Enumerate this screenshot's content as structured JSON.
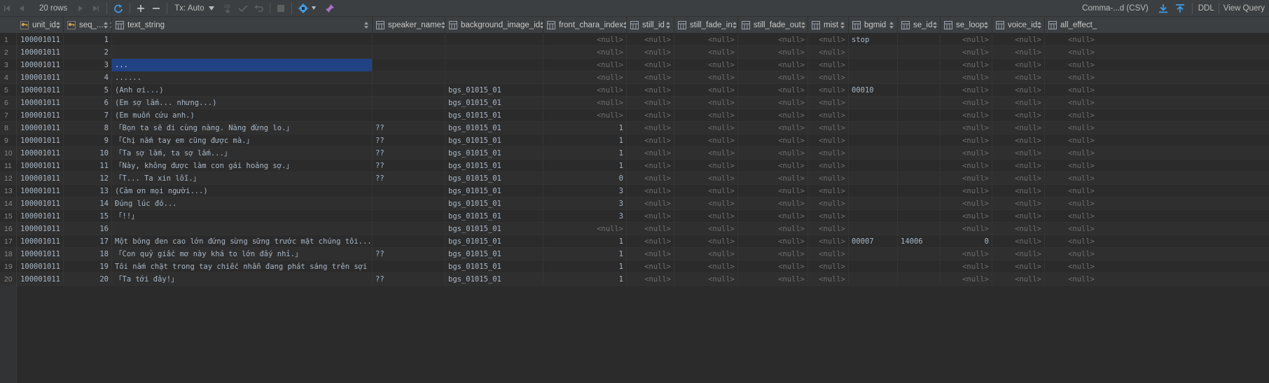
{
  "toolbar": {
    "rows_label": "20 rows",
    "tx_label": "Tx: Auto",
    "export_label": "Comma-...d (CSV)",
    "ddl_label": "DDL",
    "view_query_label": "View Query"
  },
  "columns": [
    {
      "name": "unit_id",
      "key": true,
      "sort": ""
    },
    {
      "name": "seq_...",
      "key": true,
      "sort": "1"
    },
    {
      "name": "text_string",
      "key": false,
      "sort": ""
    },
    {
      "name": "speaker_name",
      "key": false,
      "sort": ""
    },
    {
      "name": "background_image_id",
      "key": false,
      "sort": ""
    },
    {
      "name": "front_chara_index",
      "key": false,
      "sort": ""
    },
    {
      "name": "still_id",
      "key": false,
      "sort": ""
    },
    {
      "name": "still_fade_in",
      "key": false,
      "sort": ""
    },
    {
      "name": "still_fade_out",
      "key": false,
      "sort": ""
    },
    {
      "name": "mist",
      "key": false,
      "sort": ""
    },
    {
      "name": "bgmid",
      "key": false,
      "sort": ""
    },
    {
      "name": "se_id",
      "key": false,
      "sort": ""
    },
    {
      "name": "se_loop",
      "key": false,
      "sort": ""
    },
    {
      "name": "voice_id",
      "key": false,
      "sort": ""
    },
    {
      "name": "all_effect_i",
      "key": false,
      "sort": ""
    }
  ],
  "null_text": "<null>",
  "rows": [
    {
      "n": "1",
      "unit_id": "100001011",
      "seq": "1",
      "text": "",
      "speaker": "",
      "bg": "",
      "fci": "<null>",
      "still": "<null>",
      "sfi": "<null>",
      "sfo": "<null>",
      "mist": "<null>",
      "bgm": "stop",
      "se": "",
      "seloop": "<null>",
      "voice": "<null>",
      "eff": "<null>"
    },
    {
      "n": "2",
      "unit_id": "100001011",
      "seq": "2",
      "text": "",
      "speaker": "",
      "bg": "",
      "fci": "<null>",
      "still": "<null>",
      "sfi": "<null>",
      "sfo": "<null>",
      "mist": "<null>",
      "bgm": "",
      "se": "",
      "seloop": "<null>",
      "voice": "<null>",
      "eff": "<null>"
    },
    {
      "n": "3",
      "unit_id": "100001011",
      "seq": "3",
      "text": "...",
      "speaker": "",
      "bg": "",
      "fci": "<null>",
      "still": "<null>",
      "sfi": "<null>",
      "sfo": "<null>",
      "mist": "<null>",
      "bgm": "",
      "se": "",
      "seloop": "<null>",
      "voice": "<null>",
      "eff": "<null>",
      "selected": true
    },
    {
      "n": "4",
      "unit_id": "100001011",
      "seq": "4",
      "text": "......",
      "speaker": "",
      "bg": "",
      "fci": "<null>",
      "still": "<null>",
      "sfi": "<null>",
      "sfo": "<null>",
      "mist": "<null>",
      "bgm": "",
      "se": "",
      "seloop": "<null>",
      "voice": "<null>",
      "eff": "<null>"
    },
    {
      "n": "5",
      "unit_id": "100001011",
      "seq": "5",
      "text": "(Anh ơi...)",
      "speaker": "",
      "bg": "bgs_01015_01",
      "fci": "<null>",
      "still": "<null>",
      "sfi": "<null>",
      "sfo": "<null>",
      "mist": "<null>",
      "bgm": "00010",
      "se": "",
      "seloop": "<null>",
      "voice": "<null>",
      "eff": "<null>"
    },
    {
      "n": "6",
      "unit_id": "100001011",
      "seq": "6",
      "text": "(Em sợ lắm... nhưng...)",
      "speaker": "",
      "bg": "bgs_01015_01",
      "fci": "<null>",
      "still": "<null>",
      "sfi": "<null>",
      "sfo": "<null>",
      "mist": "<null>",
      "bgm": "",
      "se": "",
      "seloop": "<null>",
      "voice": "<null>",
      "eff": "<null>"
    },
    {
      "n": "7",
      "unit_id": "100001011",
      "seq": "7",
      "text": "(Em muốn cứu anh.)",
      "speaker": "",
      "bg": "bgs_01015_01",
      "fci": "<null>",
      "still": "<null>",
      "sfi": "<null>",
      "sfo": "<null>",
      "mist": "<null>",
      "bgm": "",
      "se": "",
      "seloop": "<null>",
      "voice": "<null>",
      "eff": "<null>"
    },
    {
      "n": "8",
      "unit_id": "100001011",
      "seq": "8",
      "text": "「Bọn ta sẽ đi cùng nàng. Nàng đừng lo.」",
      "speaker": "??",
      "bg": "bgs_01015_01",
      "fci": "1",
      "still": "<null>",
      "sfi": "<null>",
      "sfo": "<null>",
      "mist": "<null>",
      "bgm": "",
      "se": "",
      "seloop": "<null>",
      "voice": "<null>",
      "eff": "<null>"
    },
    {
      "n": "9",
      "unit_id": "100001011",
      "seq": "9",
      "text": "「Chị nắm tay em cũng được mà.」",
      "speaker": "??",
      "bg": "bgs_01015_01",
      "fci": "1",
      "still": "<null>",
      "sfi": "<null>",
      "sfo": "<null>",
      "mist": "<null>",
      "bgm": "",
      "se": "",
      "seloop": "<null>",
      "voice": "<null>",
      "eff": "<null>"
    },
    {
      "n": "10",
      "unit_id": "100001011",
      "seq": "10",
      "text": "「Ta sợ lắm, ta sợ lắm...」",
      "speaker": "??",
      "bg": "bgs_01015_01",
      "fci": "1",
      "still": "<null>",
      "sfi": "<null>",
      "sfo": "<null>",
      "mist": "<null>",
      "bgm": "",
      "se": "",
      "seloop": "<null>",
      "voice": "<null>",
      "eff": "<null>"
    },
    {
      "n": "11",
      "unit_id": "100001011",
      "seq": "11",
      "text": "「Này, không được làm con gái hoảng sợ.」",
      "speaker": "??",
      "bg": "bgs_01015_01",
      "fci": "1",
      "still": "<null>",
      "sfi": "<null>",
      "sfo": "<null>",
      "mist": "<null>",
      "bgm": "",
      "se": "",
      "seloop": "<null>",
      "voice": "<null>",
      "eff": "<null>"
    },
    {
      "n": "12",
      "unit_id": "100001011",
      "seq": "12",
      "text": "「T... Ta xin lỗi.」",
      "speaker": "??",
      "bg": "bgs_01015_01",
      "fci": "0",
      "still": "<null>",
      "sfi": "<null>",
      "sfo": "<null>",
      "mist": "<null>",
      "bgm": "",
      "se": "",
      "seloop": "<null>",
      "voice": "<null>",
      "eff": "<null>"
    },
    {
      "n": "13",
      "unit_id": "100001011",
      "seq": "13",
      "text": "(Cảm ơn mọi người...)",
      "speaker": "",
      "bg": "bgs_01015_01",
      "fci": "3",
      "still": "<null>",
      "sfi": "<null>",
      "sfo": "<null>",
      "mist": "<null>",
      "bgm": "",
      "se": "",
      "seloop": "<null>",
      "voice": "<null>",
      "eff": "<null>"
    },
    {
      "n": "14",
      "unit_id": "100001011",
      "seq": "14",
      "text": "Đúng lúc đó...",
      "speaker": "",
      "bg": "bgs_01015_01",
      "fci": "3",
      "still": "<null>",
      "sfi": "<null>",
      "sfo": "<null>",
      "mist": "<null>",
      "bgm": "",
      "se": "",
      "seloop": "<null>",
      "voice": "<null>",
      "eff": "<null>"
    },
    {
      "n": "15",
      "unit_id": "100001011",
      "seq": "15",
      "text": "「!!」",
      "speaker": "",
      "bg": "bgs_01015_01",
      "fci": "3",
      "still": "<null>",
      "sfi": "<null>",
      "sfo": "<null>",
      "mist": "<null>",
      "bgm": "",
      "se": "",
      "seloop": "<null>",
      "voice": "<null>",
      "eff": "<null>"
    },
    {
      "n": "16",
      "unit_id": "100001011",
      "seq": "16",
      "text": "",
      "speaker": "",
      "bg": "bgs_01015_01",
      "fci": "<null>",
      "still": "<null>",
      "sfi": "<null>",
      "sfo": "<null>",
      "mist": "<null>",
      "bgm": "",
      "se": "",
      "seloop": "<null>",
      "voice": "<null>",
      "eff": "<null>"
    },
    {
      "n": "17",
      "unit_id": "100001011",
      "seq": "17",
      "text": "Một bóng đen cao lớn đứng sừng sững trước mặt chúng tôi...",
      "speaker": "",
      "bg": "bgs_01015_01",
      "fci": "1",
      "still": "<null>",
      "sfi": "<null>",
      "sfo": "<null>",
      "mist": "<null>",
      "bgm": "00007",
      "se": "14006",
      "seloop": "0",
      "voice": "<null>",
      "eff": "<null>"
    },
    {
      "n": "18",
      "unit_id": "100001011",
      "seq": "18",
      "text": "「Con quỷ giấc mơ này khá to lớn đấy nhỉ.」",
      "speaker": "??",
      "bg": "bgs_01015_01",
      "fci": "1",
      "still": "<null>",
      "sfi": "<null>",
      "sfo": "<null>",
      "mist": "<null>",
      "bgm": "",
      "se": "",
      "seloop": "<null>",
      "voice": "<null>",
      "eff": "<null>"
    },
    {
      "n": "19",
      "unit_id": "100001011",
      "seq": "19",
      "text": "Tôi nắm chặt trong tay chiếc nhẫn đang phát sáng trên sợi dây chuyền.",
      "speaker": "",
      "bg": "bgs_01015_01",
      "fci": "1",
      "still": "<null>",
      "sfi": "<null>",
      "sfo": "<null>",
      "mist": "<null>",
      "bgm": "",
      "se": "",
      "seloop": "<null>",
      "voice": "<null>",
      "eff": "<null>"
    },
    {
      "n": "20",
      "unit_id": "100001011",
      "seq": "20",
      "text": "「Ta tới đây!」",
      "speaker": "??",
      "bg": "bgs_01015_01",
      "fci": "1",
      "still": "<null>",
      "sfi": "<null>",
      "sfo": "<null>",
      "mist": "<null>",
      "bgm": "",
      "se": "",
      "seloop": "<null>",
      "voice": "<null>",
      "eff": "<null>"
    }
  ]
}
